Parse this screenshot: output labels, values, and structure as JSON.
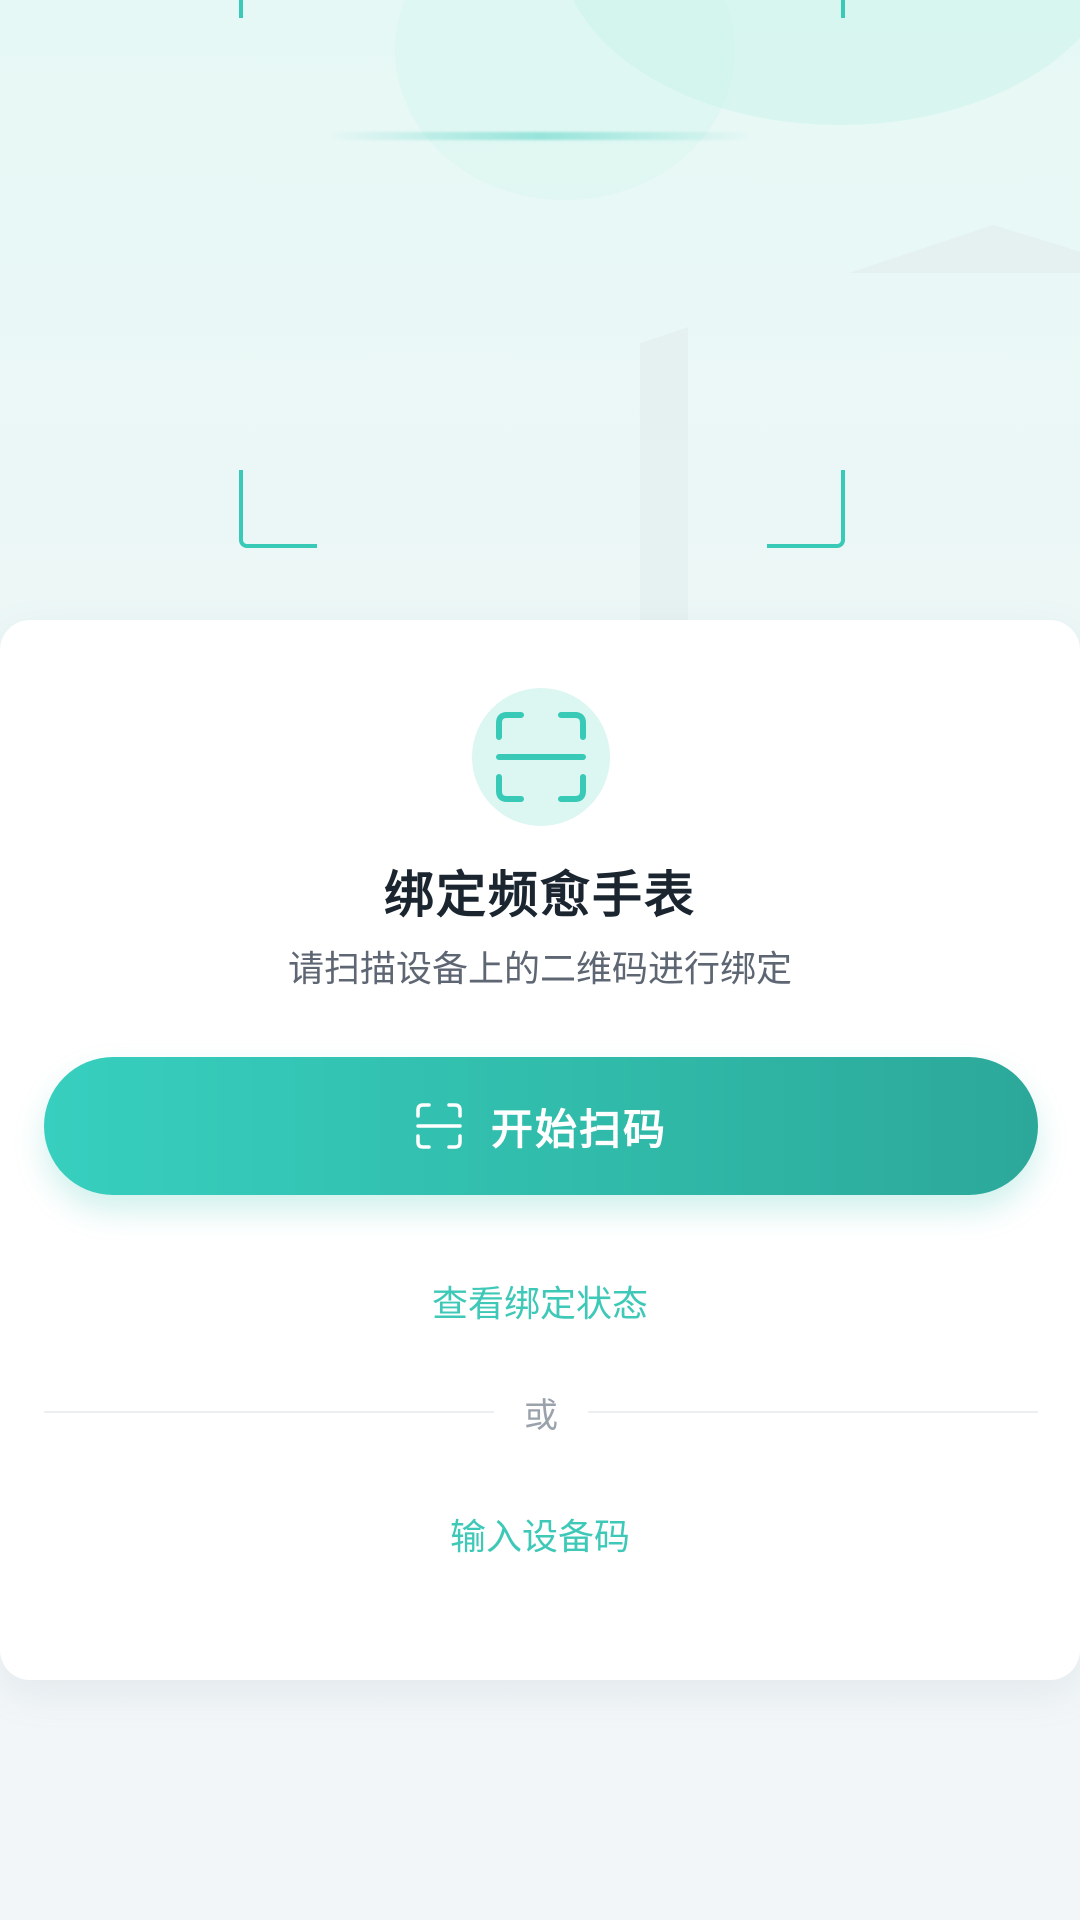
{
  "bind_card": {
    "title": "绑定频愈手表",
    "subtitle": "请扫描设备上的二维码进行绑定",
    "icon": "qr-scan-icon"
  },
  "actions": {
    "scan_button_label": "开始扫码",
    "scan_button_icon": "scan-icon",
    "view_status_label": "查看绑定状态",
    "divider_text": "或",
    "enter_code_label": "输入设备码"
  },
  "colors": {
    "accent": "#3ec8b7",
    "button_start": "#37cfbf",
    "button_end": "#2ca89a",
    "title": "#1b2530",
    "subtitle": "#5d6672"
  }
}
